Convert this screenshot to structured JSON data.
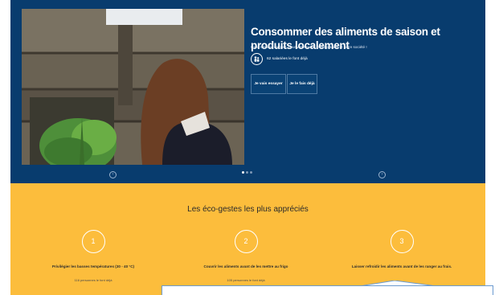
{
  "hero": {
    "title": "Consommer des aliments de saison et produits localement",
    "subtitle": "C'est meilleur en goût, pour votre santé, notre planète et notre société !",
    "stat_text": "62 salariées le font déjà",
    "stat_icon": "people-icon",
    "buttons": {
      "try": "Je vais essayer",
      "done": "Je le fais déjà"
    },
    "colors": {
      "background": "#083c6e",
      "button_border": "#4f7aa3"
    }
  },
  "carousel": {
    "prev_icon": "circle-arrow-icon",
    "next_icon": "circle-arrow-icon",
    "dots_count": 3,
    "active_dot": 1
  },
  "eco_gestes": {
    "title": "Les éco-gestes les plus appréciés",
    "background": "#fcbd3c",
    "items": [
      {
        "number": "1",
        "text": "Privilégier les basses températures (30 - 40 °C)",
        "count": "116 personnes le font déjà"
      },
      {
        "number": "2",
        "text": "Couvrir les aliments avant de les mettre au frigo",
        "count": "105 personnes le font déjà"
      },
      {
        "number": "3",
        "text": "Laisser refroidir les aliments avant de les ranger au frais.",
        "count": ""
      }
    ]
  }
}
